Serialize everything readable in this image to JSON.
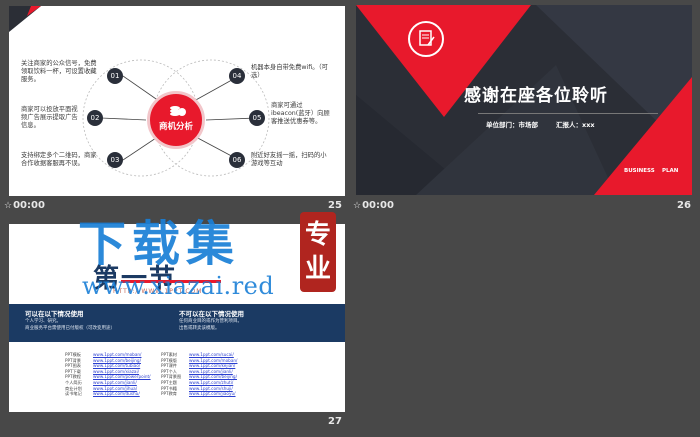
{
  "slides": [
    {
      "number": "25",
      "time": "00:00",
      "center_label": "商机分析",
      "badges": [
        "01",
        "02",
        "03",
        "04",
        "05",
        "06"
      ],
      "left_texts": [
        "关注商家的公众信号，免费领取饮料一杯，可设置收藏服务。",
        "商家可以投放平面视频广告展示提取广告信息。",
        "支持绑定多个二维码，商家合作收据客服再不误。"
      ],
      "right_texts": [
        "机器本身自带免费wifi。（可选）",
        "商家可通过ibeacon(蓝牙）向顾客推送优惠券等。",
        "附近好友摇一摇，扫码的小游戏等互动"
      ]
    },
    {
      "number": "26",
      "time": "00:00",
      "title": "感谢在座各位聆听",
      "dept_label": "单位部门：市场部",
      "reporter_label": "汇报人：xxx",
      "tag_left": "BUSINESS",
      "tag_right": "PLAN"
    },
    {
      "number": "27",
      "heading": "第一节",
      "url_text": "HTTP://WWW.1PPT.COM",
      "col_left_title": "可以在以下情况使用",
      "col_left_items": [
        "个人学习、研究。",
        "商业服务平台需使用已付版权（可改变用途）"
      ],
      "col_right_title": "不可以在以下情况使用",
      "col_right_items": [
        "任何商业目的或作为营利项目。",
        "出售或转卖该模版。"
      ],
      "list_left_labels": [
        "PPT模板",
        "PPT背景",
        "PPT图表",
        "PPT下载",
        "PPT教程",
        "个人简历",
        "商业计划",
        "读书笔记"
      ],
      "list_left_links": [
        "www.1ppt.com/moban/",
        "www.1ppt.com/beijing/",
        "www.1ppt.com/tubiao/",
        "www.1ppt.com/xiazai/",
        "www.1ppt.com/powerpoint/",
        "www.1ppt.com/jianli/",
        "www.1ppt.com/jihua/",
        "www.1ppt.com/dushu/"
      ],
      "list_right_labels": [
        "PPT素材",
        "PPT模版",
        "PPT课件",
        "PPT个人",
        "PPT背景图",
        "PPT主题",
        "PPT书籍",
        "PPT教育"
      ],
      "list_right_links": [
        "www.1ppt.com/sucai/",
        "www.1ppt.com/moban/",
        "www.1ppt.com/kejian/",
        "www.1ppt.com/jianli/",
        "www.1ppt.com/beijing/",
        "www.1ppt.com/zhuti/",
        "www.1ppt.com/shuji/",
        "www.1ppt.com/jiaoyu/"
      ]
    }
  ],
  "watermark": {
    "title": "下载集",
    "seal": "专业",
    "url": "www.xiazai.red"
  },
  "colors": {
    "accent_red": "#e8192c",
    "dark_slate": "#2b2e36",
    "navy": "#1b3a63",
    "watermark_blue": "#1a7fd6",
    "seal_red": "#b0251f"
  }
}
